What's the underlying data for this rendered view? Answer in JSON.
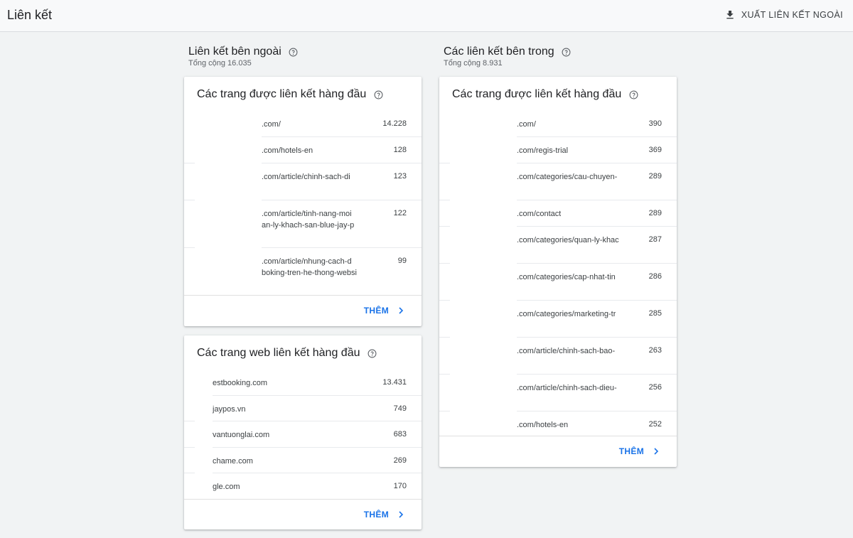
{
  "header": {
    "title": "Liên kết",
    "export_label": "XUẤT LIÊN KẾT NGOÀI"
  },
  "external": {
    "title": "Liên kết bên ngoài",
    "total": "Tổng cộng 16.035",
    "top_linked_pages": {
      "title": "Các trang được liên kết hàng đầu",
      "rows": [
        {
          "url": ".com/",
          "count": "14.228"
        },
        {
          "url": ".com/hotels-en",
          "count": "128"
        },
        {
          "url": ".com/article/chinh-sach-di",
          "count": "123"
        },
        {
          "url": ".com/article/tinh-nang-moi\nan-ly-khach-san-blue-jay-p",
          "count": "122"
        },
        {
          "url": ".com/article/nhung-cach-d\nboking-tren-he-thong-websi",
          "count": "99"
        }
      ],
      "more_label": "THÊM"
    },
    "top_linking_sites": {
      "title": "Các trang web liên kết hàng đầu",
      "rows": [
        {
          "url": "estbooking.com",
          "count": "13.431"
        },
        {
          "url": "jaypos.vn",
          "count": "749"
        },
        {
          "url": "vantuonglai.com",
          "count": "683"
        },
        {
          "url": "chame.com",
          "count": "269"
        },
        {
          "url": "gle.com",
          "count": "170"
        }
      ],
      "more_label": "THÊM"
    }
  },
  "internal": {
    "title": "Các liên kết bên trong",
    "total": "Tổng cộng 8.931",
    "top_linked_pages": {
      "title": "Các trang được liên kết hàng đầu",
      "rows": [
        {
          "url": ".com/",
          "count": "390"
        },
        {
          "url": ".com/regis-trial",
          "count": "369"
        },
        {
          "url": ".com/categories/cau-chuyen-",
          "count": "289"
        },
        {
          "url": ".com/contact",
          "count": "289"
        },
        {
          "url": ".com/categories/quan-ly-khac",
          "count": "287"
        },
        {
          "url": ".com/categories/cap-nhat-tin",
          "count": "286"
        },
        {
          "url": ".com/categories/marketing-tr",
          "count": "285"
        },
        {
          "url": ".com/article/chinh-sach-bao-",
          "count": "263"
        },
        {
          "url": ".com/article/chinh-sach-dieu-",
          "count": "256"
        },
        {
          "url": ".com/hotels-en",
          "count": "252"
        }
      ],
      "more_label": "THÊM"
    }
  }
}
